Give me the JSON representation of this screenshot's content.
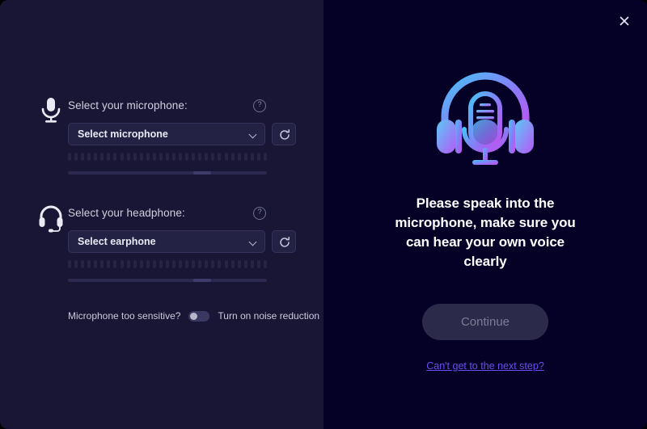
{
  "window": {
    "close_icon": "close-icon",
    "background_left": "#181634",
    "background_right": "#040026"
  },
  "left": {
    "microphone": {
      "icon": "microphone-icon",
      "label": "Select your microphone:",
      "help_icon": "?",
      "select_value": "Select microphone",
      "refresh_icon": "refresh-icon",
      "meter_segments": 31,
      "slider_value": 63
    },
    "headphone": {
      "icon": "headset-icon",
      "label": "Select your headphone:",
      "help_icon": "?",
      "select_value": "Select earphone",
      "refresh_icon": "refresh-icon",
      "meter_segments": 31,
      "slider_value": 63
    },
    "noise_reduction": {
      "question_label": "Microphone too sensitive?",
      "toggle_state": "off",
      "action_label": "Turn on noise reduction"
    }
  },
  "right": {
    "illustration": "headset-microphone-illustration",
    "prompt": "Please speak into the microphone, make sure you can hear your own voice clearly",
    "continue_label": "Continue",
    "continue_enabled": false,
    "help_link": "Can't get to the next step?",
    "accent_link_color": "#6c4df0",
    "gradient_from": "#46c3f5",
    "gradient_to": "#b558f6"
  }
}
